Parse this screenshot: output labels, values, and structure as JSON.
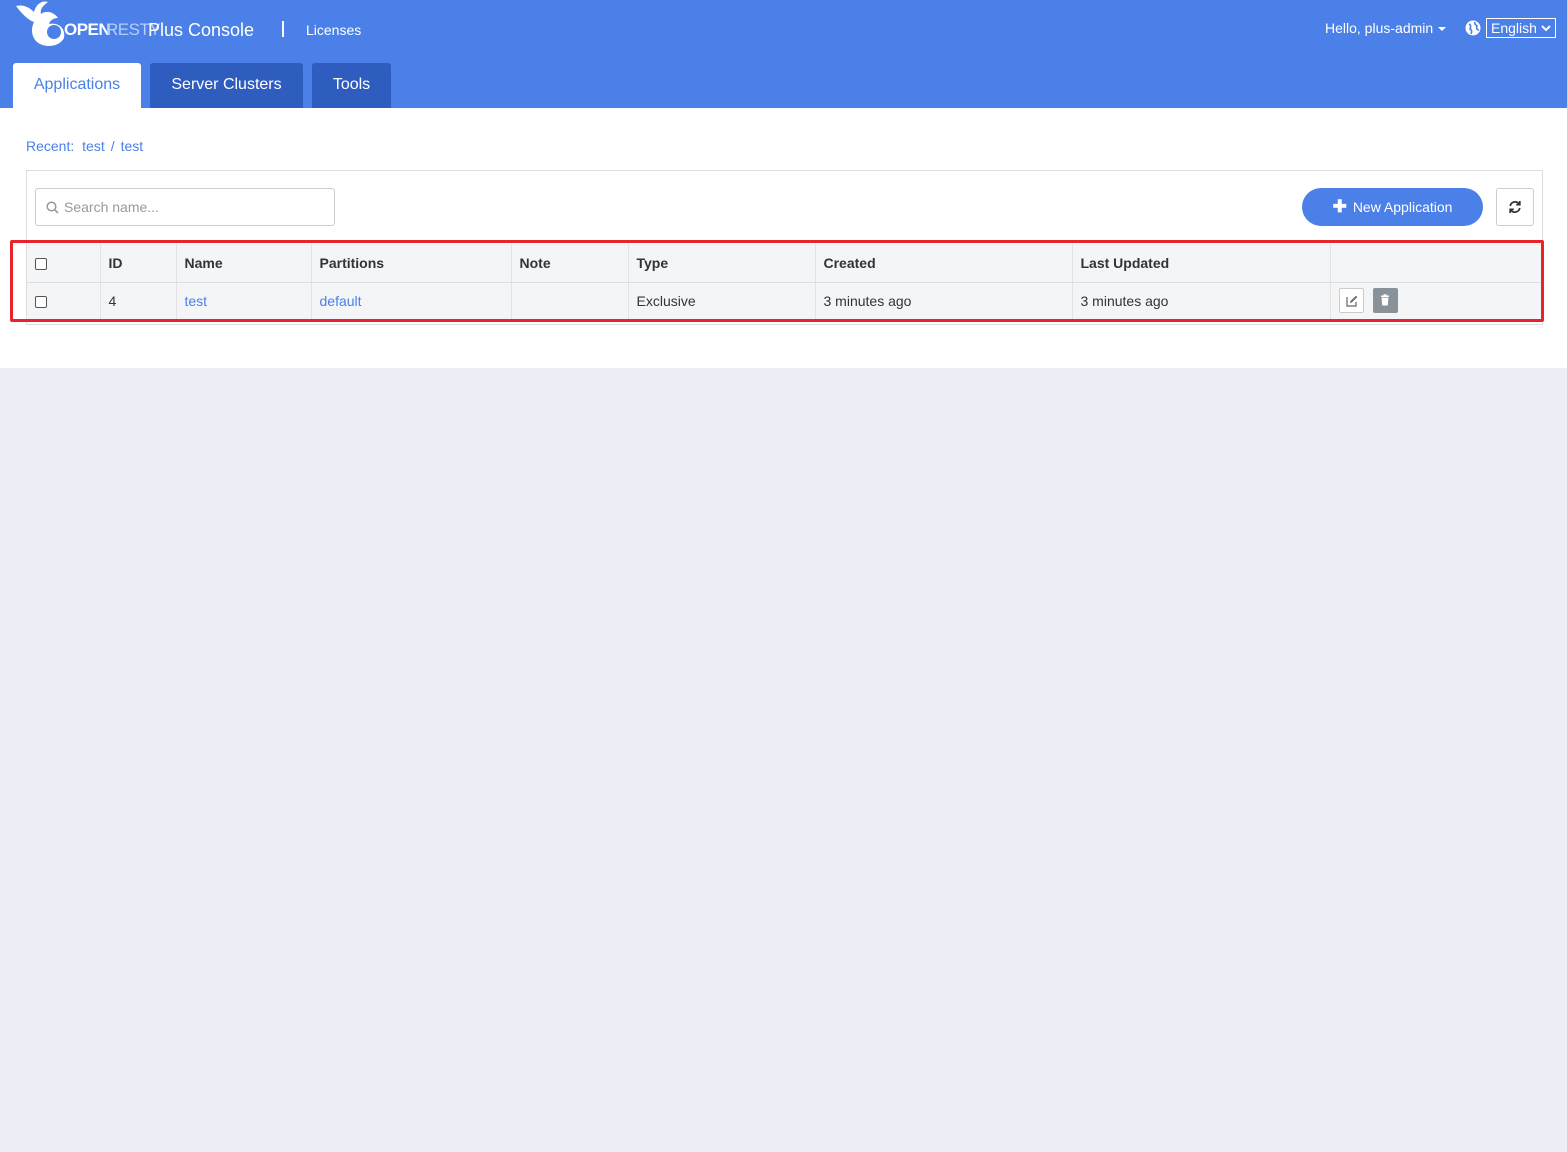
{
  "header": {
    "logo_open": "OPEN",
    "logo_resty": "RESTY",
    "app_title": "Plus Console",
    "licenses_link": "Licenses",
    "user_greeting": "Hello, plus-admin",
    "language": "English",
    "brand_color": "#4a80e8"
  },
  "tabs": [
    {
      "label": "Applications",
      "active": true
    },
    {
      "label": "Server Clusters",
      "active": false
    },
    {
      "label": "Tools",
      "active": false
    }
  ],
  "recent": {
    "label": "Recent:",
    "items": [
      "test",
      "test"
    ],
    "separator": "/"
  },
  "toolbar": {
    "search_placeholder": "Search name...",
    "search_value": "",
    "new_button_label": "New Application",
    "refresh_icon": "refresh-icon"
  },
  "table": {
    "columns": [
      "ID",
      "Name",
      "Partitions",
      "Note",
      "Type",
      "Created",
      "Last Updated"
    ],
    "rows": [
      {
        "id": "4",
        "name": "test",
        "partitions": "default",
        "note": "",
        "type": "Exclusive",
        "created": "3 minutes ago",
        "last_updated": "3 minutes ago"
      }
    ]
  },
  "annotation": {
    "highlight_color": "#e8232a"
  }
}
